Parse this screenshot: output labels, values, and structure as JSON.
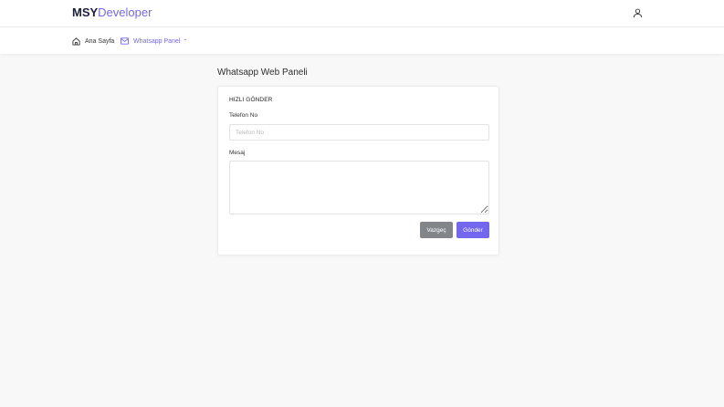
{
  "brand": {
    "part1": "MSY",
    "part2": "Developer"
  },
  "header": {
    "user_icon": "user-icon"
  },
  "nav": {
    "home_label": "Ana Sayfa",
    "home_icon": "home-icon",
    "whatsapp_label": "Whatsapp Panel",
    "whatsapp_icon": "mail-icon",
    "whatsapp_chevron": "^"
  },
  "page": {
    "title": "Whatsapp Web Paneli"
  },
  "form": {
    "card_title": "HIZLI GÖNDER",
    "phone_label": "Telefon No",
    "phone_placeholder": "Telefon No",
    "phone_value": "",
    "message_label": "Mesaj",
    "message_value": "",
    "cancel_label": "Vazgeç",
    "send_label": "Gönder"
  },
  "colors": {
    "accent": "#7367f0",
    "secondary_button": "#82868b",
    "brand_dark": "#1a1f3d"
  }
}
